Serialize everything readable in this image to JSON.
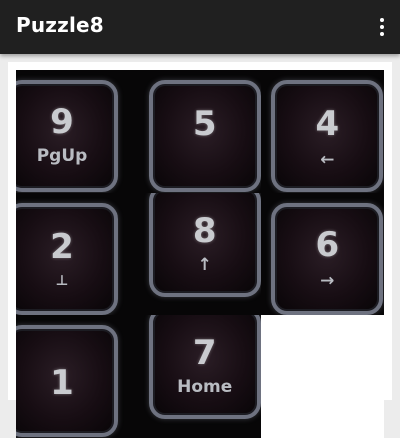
{
  "appbar": {
    "title": "Puzzle8"
  },
  "board": {
    "tiles": [
      {
        "number": "9",
        "sub": "PgUp"
      },
      {
        "number": "5",
        "sub": ""
      },
      {
        "number": "4",
        "sub": "←"
      },
      {
        "number": "2",
        "sub": "⊥"
      },
      {
        "number": "8",
        "sub": "↑"
      },
      {
        "number": "6",
        "sub": "→"
      },
      {
        "number": "1",
        "sub": ""
      },
      {
        "number": "7",
        "sub": "Home"
      }
    ]
  }
}
